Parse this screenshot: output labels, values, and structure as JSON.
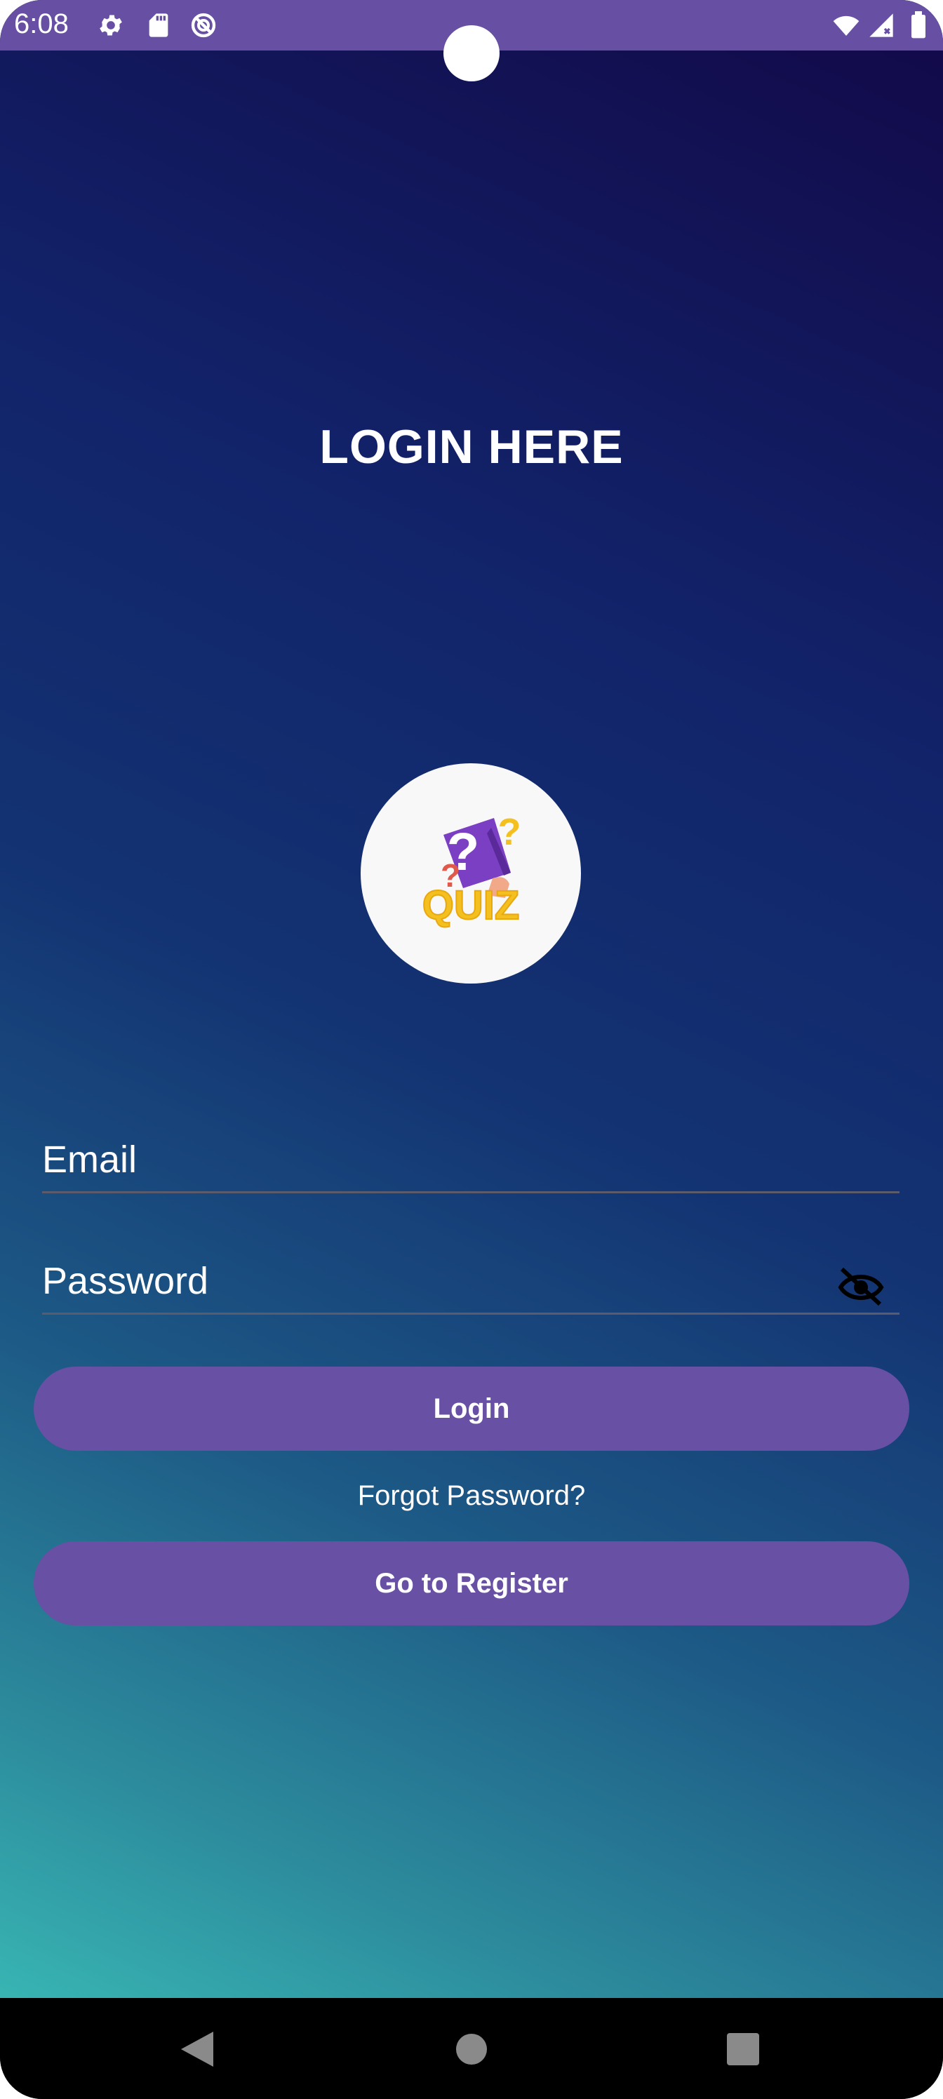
{
  "status_bar": {
    "time": "6:08",
    "left_icons": [
      "settings-icon",
      "sd-card-icon",
      "do-not-disturb-icon"
    ],
    "right_icons": [
      "wifi-icon",
      "cellular-signal-icon",
      "battery-icon"
    ],
    "background": "#6750a4"
  },
  "page": {
    "title": "LOGIN HERE",
    "logo_text": "QUIZ"
  },
  "form": {
    "email_placeholder": "Email",
    "password_placeholder": "Password",
    "password_toggle_icon": "visibility-off-icon"
  },
  "actions": {
    "login_label": "Login",
    "forgot_label": "Forgot Password?",
    "register_label": "Go to Register",
    "button_color": "#6850a4"
  },
  "nav_bar": {
    "icons": [
      "back-icon",
      "home-icon",
      "recents-icon"
    ]
  },
  "colors": {
    "gradient_top": "#120a4a",
    "gradient_mid": "#133372",
    "gradient_bottom": "#38b5b3"
  }
}
